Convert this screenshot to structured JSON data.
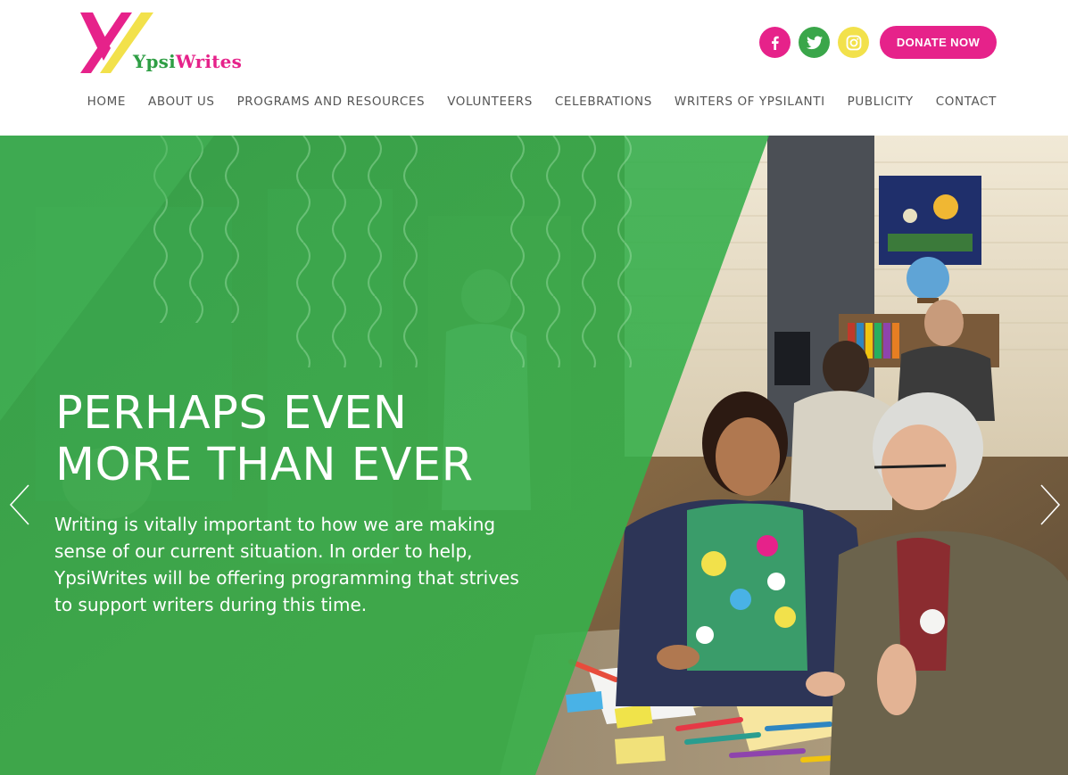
{
  "brand": {
    "name_ypsi": "Ypsi",
    "name_writes": "Writes",
    "colors": {
      "pink": "#e6228a",
      "green": "#3aa64a",
      "yellow": "#f2e14b"
    }
  },
  "header": {
    "social": [
      {
        "icon": "facebook-icon"
      },
      {
        "icon": "twitter-icon"
      },
      {
        "icon": "instagram-icon"
      }
    ],
    "donate_label": "DONATE NOW"
  },
  "nav": {
    "items": [
      {
        "label": "HOME"
      },
      {
        "label": "ABOUT US"
      },
      {
        "label": "PROGRAMS AND RESOURCES"
      },
      {
        "label": "VOLUNTEERS"
      },
      {
        "label": "CELEBRATIONS"
      },
      {
        "label": "WRITERS OF YPSILANTI"
      },
      {
        "label": "PUBLICITY"
      },
      {
        "label": "CONTACT"
      }
    ]
  },
  "hero": {
    "title_line1": "PERHAPS EVEN",
    "title_line2": "MORE THAN EVER",
    "body": "Writing is vitally important to how we are making sense of our current situation. In order to help, YpsiWrites will be offering programming that strives to support writers during this time.",
    "prev_icon": "chevron-left-icon",
    "next_icon": "chevron-right-icon"
  }
}
